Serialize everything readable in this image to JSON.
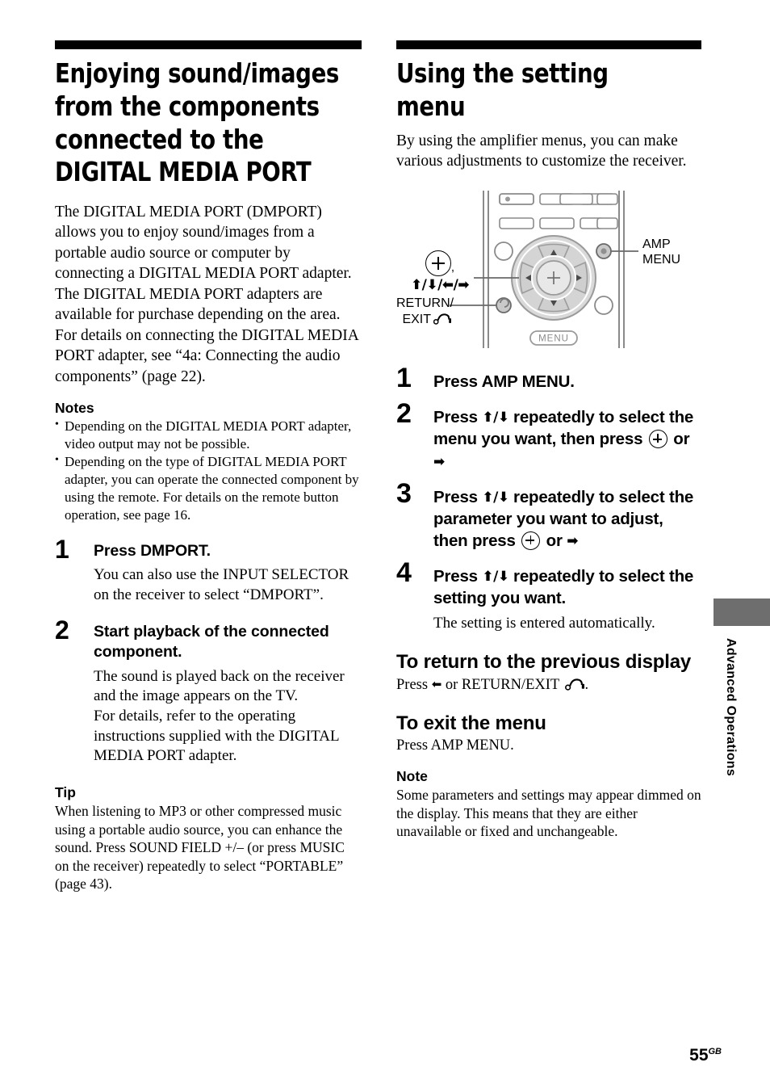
{
  "page": {
    "number": "55",
    "region_code": "GB",
    "side_tab_label": "Advanced Operations",
    "tab_color": "#6e6e6e"
  },
  "left_column": {
    "title": "Enjoying sound/images from the components connected to the DIGITAL MEDIA PORT",
    "intro_paragraph_1": "The DIGITAL MEDIA PORT (DMPORT) allows you to enjoy sound/images from a portable audio source or computer by connecting a DIGITAL MEDIA PORT adapter.",
    "intro_paragraph_2": "The DIGITAL MEDIA PORT adapters are available for purchase depending on the area. For details on connecting the DIGITAL MEDIA PORT adapter, see “4a: Connecting the audio components” (page 22).",
    "notes_heading": "Notes",
    "notes": [
      "Depending on the DIGITAL MEDIA PORT adapter, video output may not be possible.",
      "Depending on the type of DIGITAL MEDIA PORT adapter, you can operate the connected component by using the remote. For details on the remote button operation, see page 16."
    ],
    "steps": [
      {
        "number": "1",
        "lead": "Press DMPORT.",
        "detail": "You can also use the INPUT SELECTOR on the receiver to select “DMPORT”."
      },
      {
        "number": "2",
        "lead": "Start playback of the connected component.",
        "detail_1": "The sound is played back on the receiver and the image appears on the TV.",
        "detail_2": "For details, refer to the operating instructions supplied with the DIGITAL MEDIA PORT adapter."
      }
    ],
    "tip_heading": "Tip",
    "tip_text": "When listening to MP3 or other compressed music using a portable audio source, you can enhance the sound. Press SOUND FIELD +/– (or press MUSIC on the receiver) repeatedly to select “PORTABLE” (page 43)."
  },
  "right_column": {
    "title": "Using the setting menu",
    "intro": "By using the amplifier menus, you can make various adjustments to customize the receiver.",
    "illustration": {
      "callout_amp_menu_line1": "AMP",
      "callout_amp_menu_line2": "MENU",
      "callout_arrows": "⬆/⬇/⬅/➡",
      "callout_return_line1": "RETURN/",
      "callout_return_line2": "EXIT",
      "menu_button_label": "MENU"
    },
    "steps": [
      {
        "number": "1",
        "lead_part1": "Press AMP MENU.",
        "lead_part2": "",
        "lead_part3": ""
      },
      {
        "number": "2",
        "lead_part1": "Press ",
        "lead_part2": " repeatedly to select the menu you want, then press ",
        "lead_part3": " or "
      },
      {
        "number": "3",
        "lead_part1": "Press ",
        "lead_part2": " repeatedly to select the parameter you want to adjust, then press ",
        "lead_part3": " or "
      },
      {
        "number": "4",
        "lead_part1": "Press ",
        "lead_part2": " repeatedly to select the setting you want.",
        "lead_part3": "",
        "detail": "The setting is entered automatically."
      }
    ],
    "sub_return_heading": "To return to the previous display",
    "sub_return_text_before": "Press ",
    "sub_return_text_after": " or RETURN/EXIT ",
    "sub_exit_heading": "To exit the menu",
    "sub_exit_text": "Press AMP MENU.",
    "note_heading": "Note",
    "note_text": "Some parameters and settings may appear dimmed on the display. This means that they are either unavailable or fixed and unchangeable."
  }
}
